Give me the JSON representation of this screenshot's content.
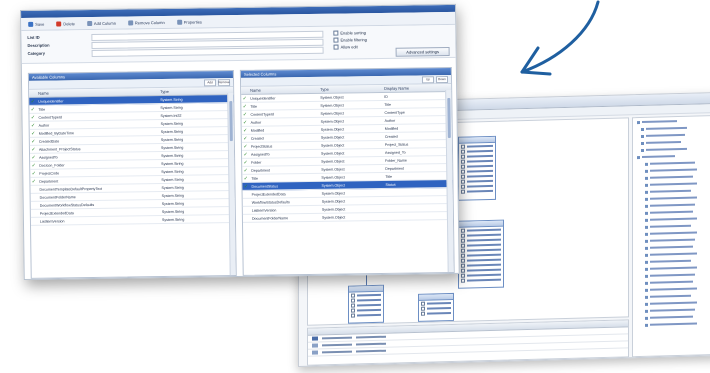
{
  "toolbar": {
    "items": [
      {
        "label": "Save"
      },
      {
        "label": "Delete"
      },
      {
        "label": "Add Column"
      },
      {
        "label": "Remove Column"
      },
      {
        "label": "Properties"
      }
    ]
  },
  "form": {
    "labels": {
      "name": "List ID",
      "description": "Description",
      "category": "Category"
    },
    "checkboxes": [
      "Enable sorting",
      "Enable filtering",
      "Allow edit"
    ],
    "button": "Advanced settings"
  },
  "left_pane": {
    "title": "Available Columns",
    "search_buttons": [
      "Add",
      "Remove"
    ],
    "headers": [
      "Name",
      "Type"
    ],
    "rows": [
      {
        "checked": true,
        "name": "UniqueIdentifier",
        "type": "System.String",
        "selected": true
      },
      {
        "checked": true,
        "name": "Title",
        "type": "System.String"
      },
      {
        "checked": true,
        "name": "ContentTypeId",
        "type": "System.Int32"
      },
      {
        "checked": true,
        "name": "Author",
        "type": "System.String"
      },
      {
        "checked": true,
        "name": "Modified_ByDateTime",
        "type": "System.String"
      },
      {
        "checked": true,
        "name": "CreatedDate",
        "type": "System.String"
      },
      {
        "checked": true,
        "name": "Attachment_ProjectStatus",
        "type": "System.String"
      },
      {
        "checked": true,
        "name": "AssignedTo",
        "type": "System.String"
      },
      {
        "checked": true,
        "name": "DocIcon_Folder",
        "type": "System.String"
      },
      {
        "checked": true,
        "name": "ProjectCode",
        "type": "System.String"
      },
      {
        "checked": true,
        "name": "Department",
        "type": "System.String"
      },
      {
        "checked": false,
        "name": "DocumentTemplateDefaultPropertyText",
        "type": "System.String"
      },
      {
        "checked": false,
        "name": "DocumentFolderName",
        "type": "System.String"
      },
      {
        "checked": false,
        "name": "DocumentWorkflowStatusDefaults",
        "type": "System.String"
      },
      {
        "checked": false,
        "name": "ProjectExtendedData",
        "type": "System.String"
      },
      {
        "checked": false,
        "name": "ListItemVersion",
        "type": "System.String"
      }
    ]
  },
  "right_pane": {
    "title": "Selected Columns",
    "search_buttons": [
      "Up",
      "Down"
    ],
    "headers": [
      "Name",
      "Type",
      "Display Name"
    ],
    "rows": [
      {
        "checked": true,
        "name": "UniqueIdentifier",
        "type": "System.Object",
        "display": "ID"
      },
      {
        "checked": true,
        "name": "Title",
        "type": "System.Object",
        "display": "Title"
      },
      {
        "checked": true,
        "name": "ContentTypeId",
        "type": "System.Object",
        "display": "ContentType"
      },
      {
        "checked": true,
        "name": "Author",
        "type": "System.Object",
        "display": "Author"
      },
      {
        "checked": true,
        "name": "Modified",
        "type": "System.Object",
        "display": "Modified"
      },
      {
        "checked": true,
        "name": "Created",
        "type": "System.Object",
        "display": "Created"
      },
      {
        "checked": true,
        "name": "ProjectStatus",
        "type": "System.Object",
        "display": "Project_Status"
      },
      {
        "checked": true,
        "name": "AssignedTo",
        "type": "System.Object",
        "display": "Assigned_To"
      },
      {
        "checked": true,
        "name": "Folder",
        "type": "System.Object",
        "display": "Folder_Name"
      },
      {
        "checked": true,
        "name": "Department",
        "type": "System.Object",
        "display": "Department"
      },
      {
        "checked": true,
        "name": "Title",
        "type": "System.Object",
        "display": "Title"
      },
      {
        "checked": true,
        "name": "DocumentStatus",
        "type": "System.Object",
        "display": "Status",
        "highlight": true
      },
      {
        "checked": false,
        "name": "ProjectExtendedData",
        "type": "System.Object",
        "display": ""
      },
      {
        "checked": false,
        "name": "WorkflowStatusDefaults",
        "type": "System.Object",
        "display": ""
      },
      {
        "checked": false,
        "name": "ListItemVersion",
        "type": "System.Object",
        "display": ""
      },
      {
        "checked": false,
        "name": "DocumentFolderName",
        "type": "System.Object",
        "display": ""
      }
    ]
  },
  "colors": {
    "accent": "#2f63c0",
    "arrow": "#1f5fa0"
  }
}
